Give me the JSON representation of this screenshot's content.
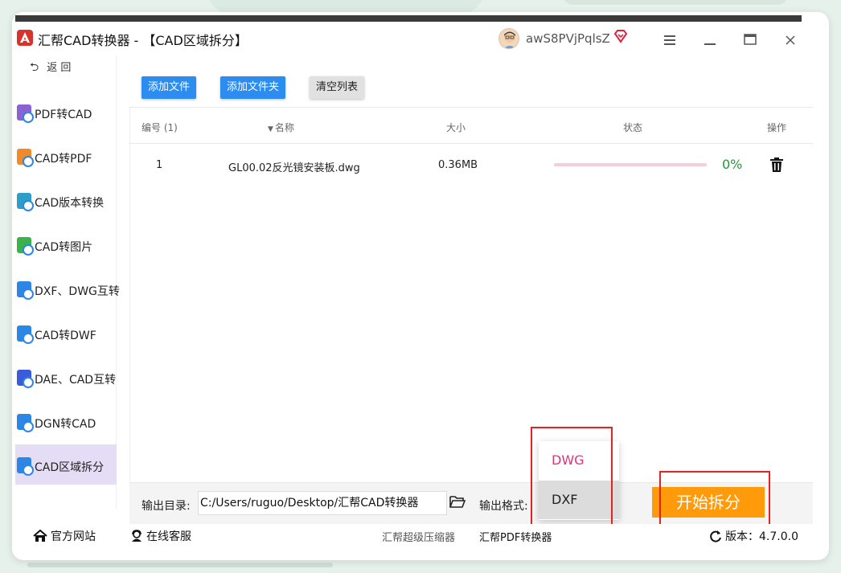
{
  "window": {
    "title": "汇帮CAD转换器 - 【CAD区域拆分】",
    "username": "awS8PVjPqlsZ",
    "menu_icon": "hamburger-icon",
    "minimize_icon": "minimize-icon",
    "maximize_icon": "maximize-icon",
    "close_icon": "close-icon"
  },
  "sidebar": {
    "back_label": "返 回",
    "items": [
      {
        "label": "PDF转CAD"
      },
      {
        "label": "CAD转PDF"
      },
      {
        "label": "CAD版本转换"
      },
      {
        "label": "CAD转图片"
      },
      {
        "label": "DXF、DWG互转"
      },
      {
        "label": "CAD转DWF"
      },
      {
        "label": "DAE、CAD互转"
      },
      {
        "label": "DGN转CAD"
      },
      {
        "label": "CAD区域拆分"
      }
    ]
  },
  "toolbar": {
    "add_file": "添加文件",
    "add_folder": "添加文件夹",
    "clear_list": "清空列表"
  },
  "table": {
    "headers": {
      "number": "编号 (1)",
      "name": "名称",
      "size": "大小",
      "status": "状态",
      "action": "操作"
    },
    "rows": [
      {
        "number": "1",
        "name": "GL00.02反光镜安装板.dwg",
        "size": "0.36MB",
        "progress": 0,
        "percent": "0%"
      }
    ]
  },
  "output": {
    "dir_label": "输出目录:",
    "dir_value": "C:/Users/ruguo/Desktop/汇帮CAD转换器",
    "format_label": "输出格式:",
    "format_options": [
      "DWG",
      "DXF"
    ],
    "selected_format": "DWG",
    "highlighted_format": "DXF"
  },
  "start_button": "开始拆分",
  "footer": {
    "website": "官方网站",
    "service": "在线客服",
    "compressor": "汇帮超级压缩器",
    "pdf_converter": "汇帮PDF转换器",
    "version": "版本：4.7.0.0"
  },
  "colors": {
    "accent_blue": "#2d8cf0",
    "start_orange": "#ff9a0b",
    "progress_green": "#1d9d32",
    "selected_pink": "#e0337a",
    "annotation_red": "#e52121",
    "active_sidebar": "#e5dcf5"
  }
}
